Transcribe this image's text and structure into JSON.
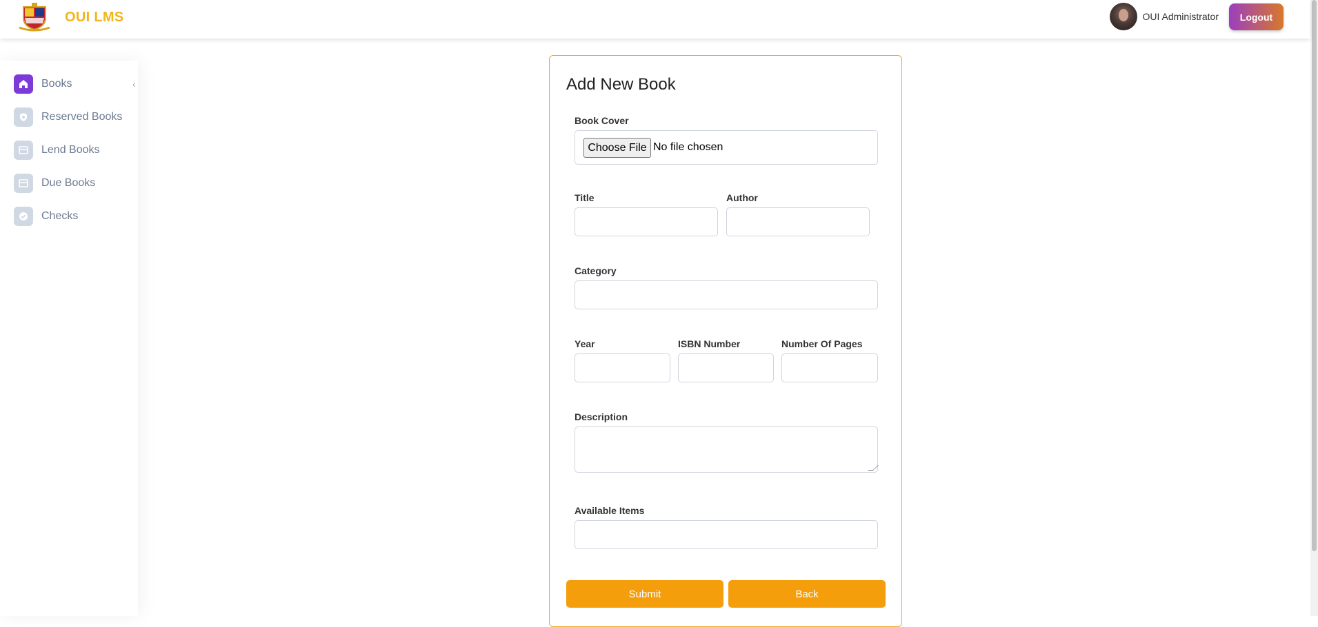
{
  "header": {
    "brand": "OUI LMS",
    "username": "OUI Administrator",
    "logout_label": "Logout"
  },
  "sidebar": {
    "items": [
      {
        "label": "Books",
        "icon": "home-icon",
        "active": true
      },
      {
        "label": "Reserved Books",
        "icon": "shield-icon",
        "active": false
      },
      {
        "label": "Lend Books",
        "icon": "card-icon",
        "active": false
      },
      {
        "label": "Due Books",
        "icon": "card-icon",
        "active": false
      },
      {
        "label": "Checks",
        "icon": "check-badge-icon",
        "active": false
      }
    ]
  },
  "form": {
    "title": "Add New Book",
    "book_cover_label": "Book Cover",
    "choose_file_label": "Choose File",
    "no_file_text": "No file chosen",
    "title_label": "Title",
    "author_label": "Author",
    "category_label": "Category",
    "year_label": "Year",
    "isbn_label": "ISBN Number",
    "pages_label": "Number Of Pages",
    "description_label": "Description",
    "available_label": "Available Items",
    "submit_label": "Submit",
    "back_label": "Back"
  },
  "colors": {
    "accent": "#f59e0b",
    "brand": "#f1b51c",
    "active_nav": "#7e3ad8"
  }
}
